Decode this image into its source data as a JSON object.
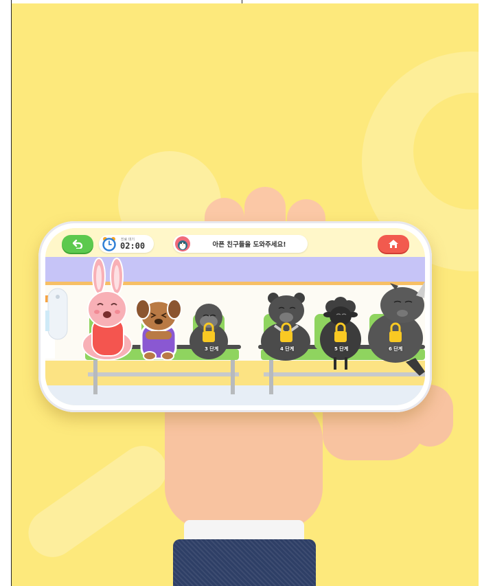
{
  "colors": {
    "background": "#fde97c",
    "back_button": "#5cc94e",
    "home_button": "#f25a4e",
    "wall": "#c6c4f7",
    "seat": "#8fd45f",
    "lock": "#f9c923"
  },
  "topbar": {
    "back_icon": "undo-arrow-icon",
    "timer": {
      "label": "진료 대기",
      "value": "02:00",
      "icon": "alarm-clock-icon"
    },
    "mission": {
      "text": "아픈 친구들을 도와주세요!",
      "avatar_icon": "penguin-avatar-icon"
    },
    "home_icon": "home-icon"
  },
  "characters": [
    {
      "name": "bunny",
      "locked": false
    },
    {
      "name": "puppy",
      "locked": false
    },
    {
      "name": "gorilla",
      "locked": true,
      "stage": "3 단계"
    },
    {
      "name": "bear",
      "locked": true,
      "stage": "4 단계"
    },
    {
      "name": "sheep",
      "locked": true,
      "stage": "5 단계"
    },
    {
      "name": "rhino",
      "locked": true,
      "stage": "6 단계"
    }
  ]
}
